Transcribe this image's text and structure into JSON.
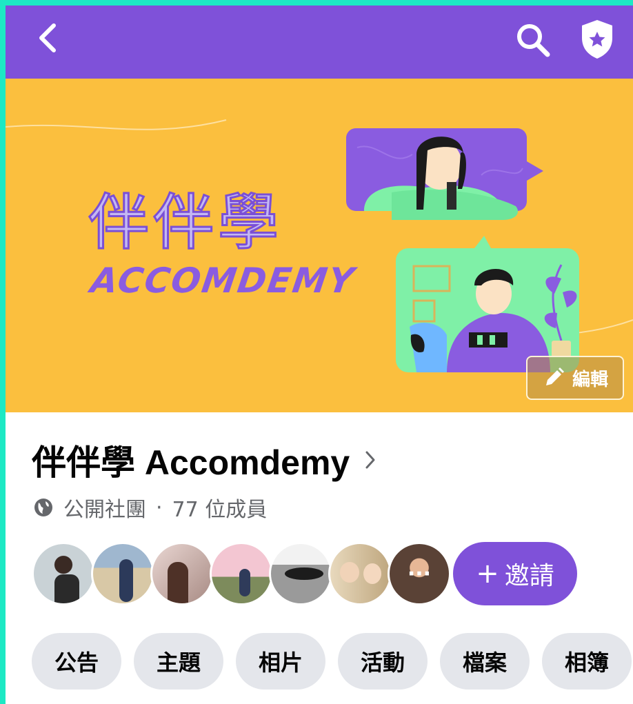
{
  "header": {
    "back_icon": "chevron-left-icon",
    "search_icon": "search-icon",
    "admin_icon": "shield-star-icon",
    "bar_color": "#7f51d9"
  },
  "cover": {
    "title_zh": "伴伴學",
    "title_en": "ACCOMDEMY",
    "background_color": "#fbbf3e",
    "edit_label": "編輯"
  },
  "group": {
    "name": "伴伴學 Accomdemy",
    "privacy": "公開社團",
    "separator": "·",
    "members_count": "77 位成員"
  },
  "members": {
    "avatars": [
      {
        "name": "member-avatar-1",
        "color": "#6f7a7e"
      },
      {
        "name": "member-avatar-2",
        "color": "#b9a98d"
      },
      {
        "name": "member-avatar-3",
        "color": "#6d4a3c"
      },
      {
        "name": "member-avatar-4",
        "color": "#c89aa8"
      },
      {
        "name": "member-avatar-5",
        "color": "#8c8c8c"
      },
      {
        "name": "member-avatar-6",
        "color": "#d8c7a4"
      },
      {
        "name": "member-avatar-7",
        "color": "#5a4236"
      }
    ],
    "more_label": "···",
    "invite_label": "邀請",
    "invite_prefix": "+"
  },
  "tabs": [
    "公告",
    "主題",
    "相片",
    "活動",
    "檔案",
    "相簿"
  ]
}
